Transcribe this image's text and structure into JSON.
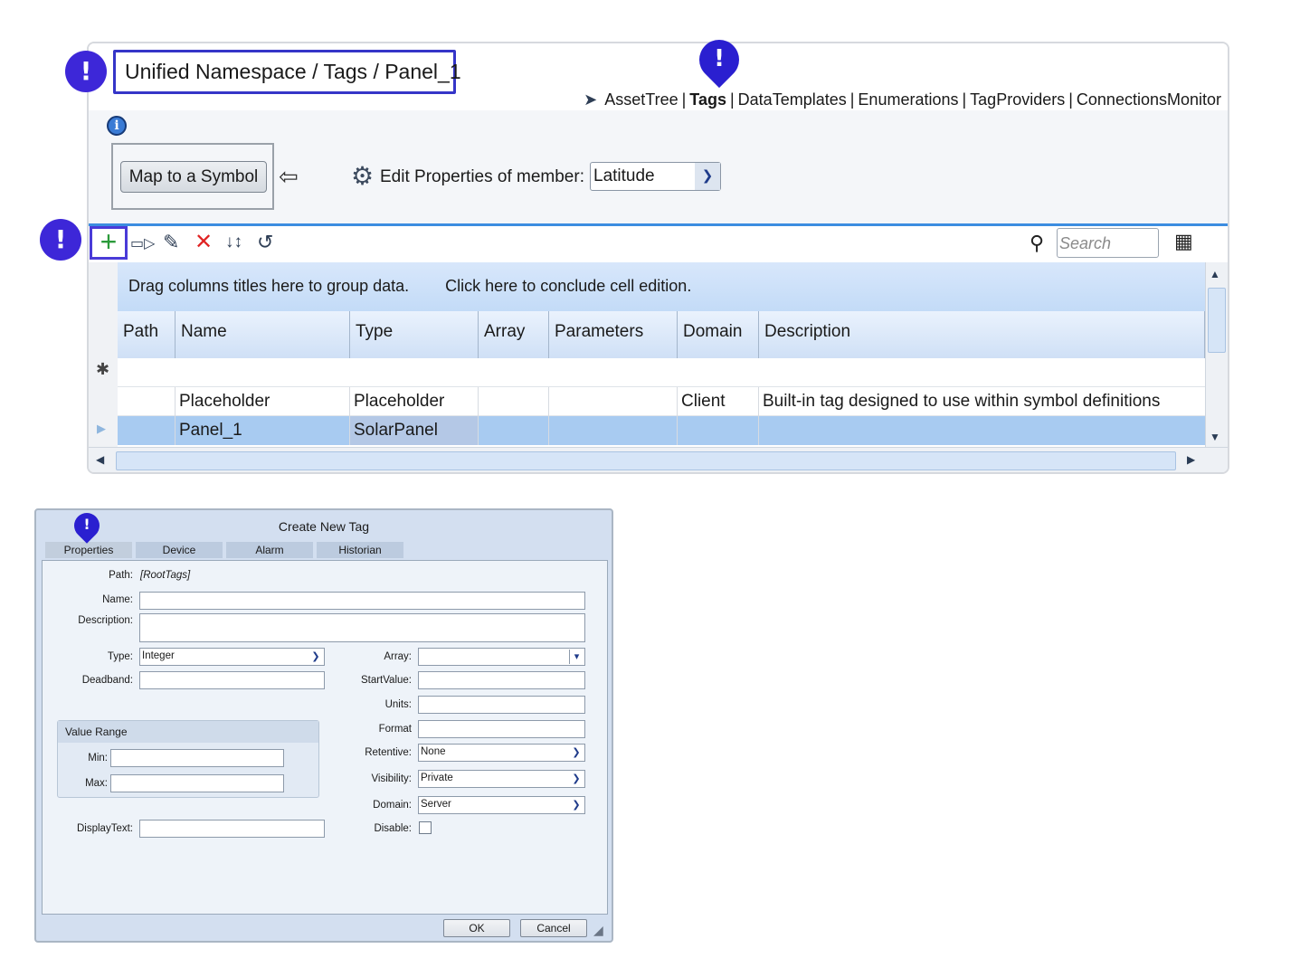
{
  "header": {
    "breadcrumb": "Unified Namespace / Tags / Panel_1",
    "nav": [
      {
        "label": "AssetTree",
        "active": false
      },
      {
        "label": "Tags",
        "active": true
      },
      {
        "label": "DataTemplates",
        "active": false
      },
      {
        "label": "Enumerations",
        "active": false
      },
      {
        "label": "TagProviders",
        "active": false
      },
      {
        "label": "ConnectionsMonitor",
        "active": false
      }
    ],
    "nav_separator": "|"
  },
  "symbol_section": {
    "map_button": "Map to a Symbol",
    "edit_label": "Edit Properties of member:",
    "member_value": "Latitude"
  },
  "toolbar": {
    "search_placeholder": "Search"
  },
  "grid": {
    "group_hint": "Drag columns titles here to group data.",
    "conclude_hint": "Click here to conclude cell edition.",
    "columns": [
      "Path",
      "Name",
      "Type",
      "Array",
      "Parameters",
      "Domain",
      "Description"
    ],
    "rows": [
      {
        "path": "",
        "name": "Placeholder",
        "type": "Placeholder",
        "array": "",
        "parameters": "",
        "domain": "Client",
        "description": "Built-in tag designed to use within symbol definitions"
      },
      {
        "path": "",
        "name": "Panel_1",
        "type": "SolarPanel",
        "array": "",
        "parameters": "",
        "domain": "",
        "description": ""
      }
    ]
  },
  "markers": [
    "!",
    "!",
    "!",
    "!"
  ],
  "dialog": {
    "title": "Create New Tag",
    "tabs": [
      "Properties",
      "Device",
      "Alarm",
      "Historian"
    ],
    "fields": {
      "path_label": "Path:",
      "path_value": "[RootTags]",
      "name_label": "Name:",
      "name_value": "",
      "description_label": "Description:",
      "description_value": "",
      "type_label": "Type:",
      "type_value": "Integer",
      "deadband_label": "Deadband:",
      "array_label": "Array:",
      "startvalue_label": "StartValue:",
      "units_label": "Units:",
      "format_label": "Format",
      "retentive_label": "Retentive:",
      "retentive_value": "None",
      "visibility_label": "Visibility:",
      "visibility_value": "Private",
      "domain_label": "Domain:",
      "domain_value": "Server",
      "disable_label": "Disable:",
      "value_range_title": "Value Range",
      "min_label": "Min:",
      "max_label": "Max:",
      "displaytext_label": "DisplayText:"
    },
    "ok_label": "OK",
    "cancel_label": "Cancel"
  },
  "colors": {
    "accent": "#3d27d8",
    "selected_row": "#a8cbf1",
    "header_gradient": "#cfe0f6",
    "add_icon": "#2b9a3a",
    "delete_icon": "#e02424"
  },
  "icons": [
    "info-icon",
    "back-arrow-icon",
    "gear-icon",
    "add-icon",
    "rename-icon",
    "edit-icon",
    "delete-icon",
    "sort-icon",
    "history-icon",
    "search-icon",
    "columns-icon",
    "tag-icon"
  ]
}
